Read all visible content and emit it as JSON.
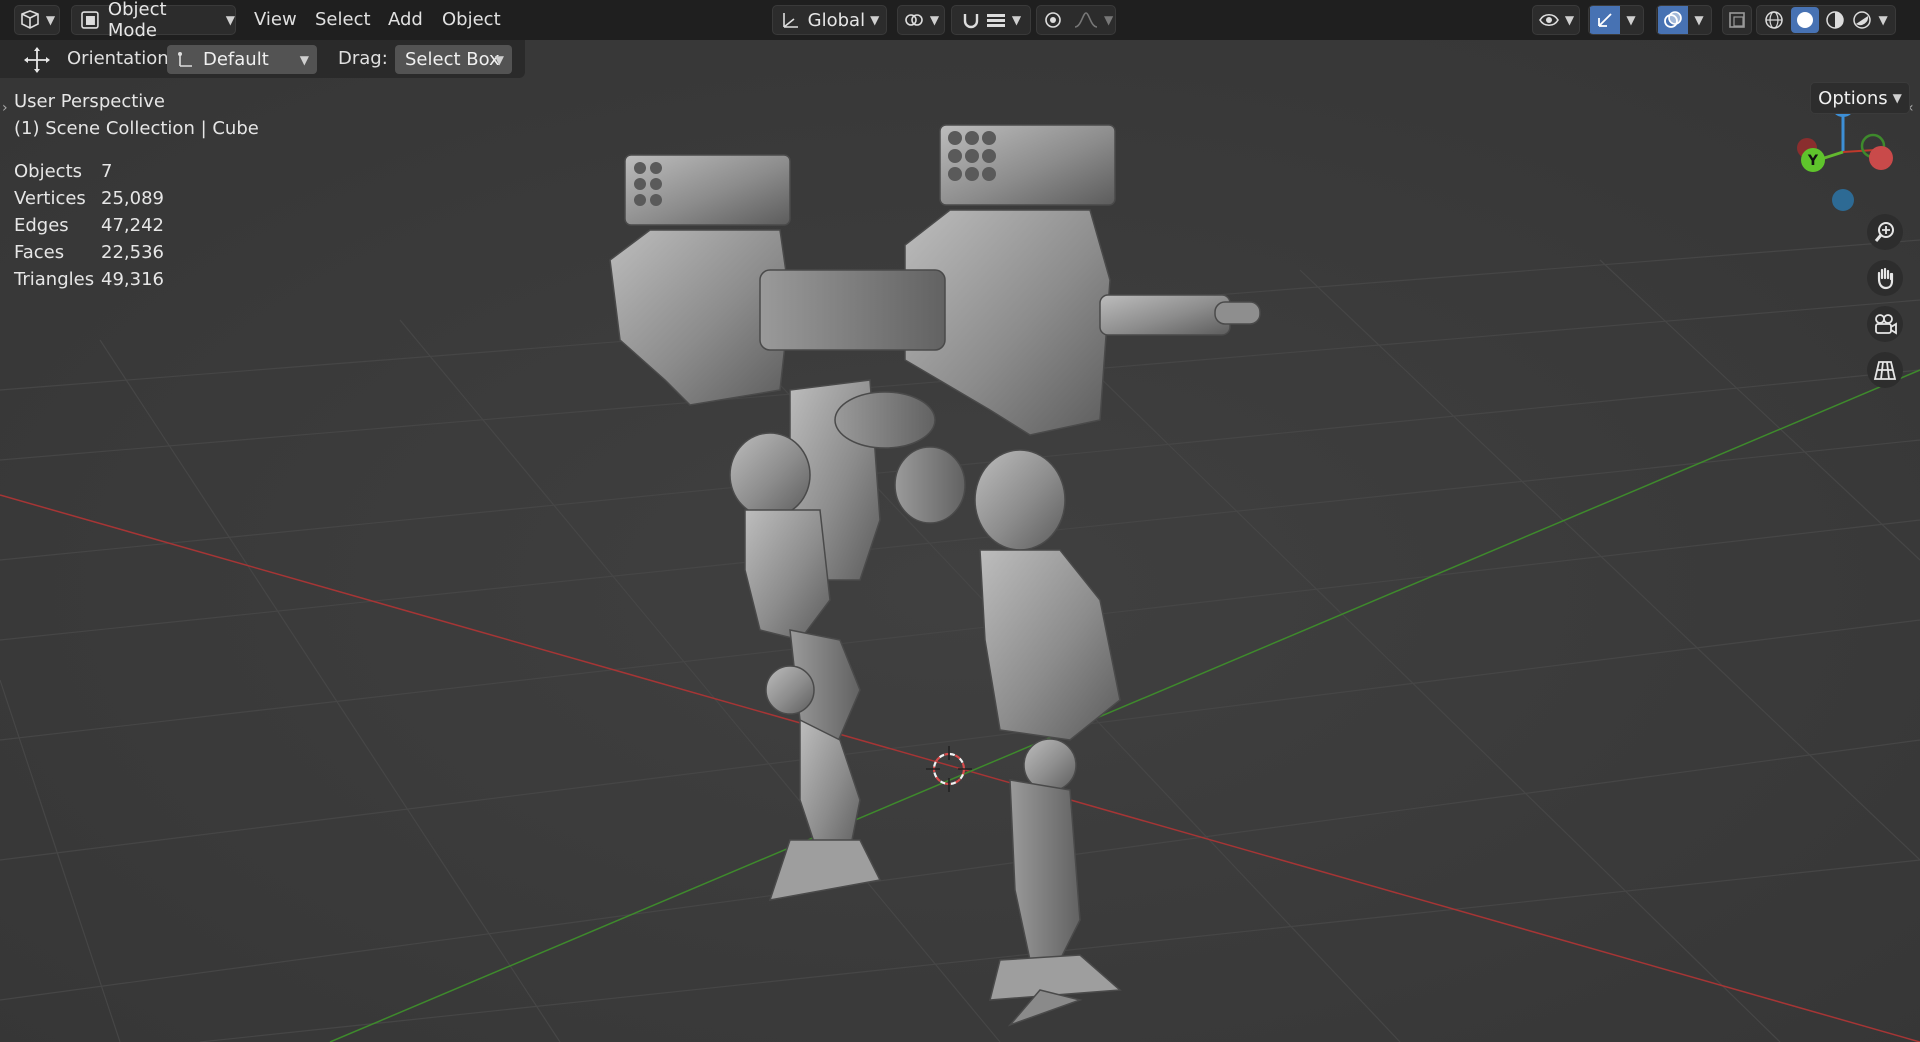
{
  "header": {
    "editor_type_icon": "viewport-editor-icon",
    "mode_label": "Object Mode",
    "menus": [
      "View",
      "Select",
      "Add",
      "Object"
    ],
    "transform_orientation": "Global"
  },
  "tool_settings": {
    "orientation_label": "Orientation:",
    "orientation_value": "Default",
    "drag_label": "Drag:",
    "drag_value": "Select Box"
  },
  "viewport": {
    "perspective_label": "User Perspective",
    "collection_label": "(1) Scene Collection | Cube",
    "options_label": "Options",
    "stats": [
      {
        "name": "Objects",
        "value": "7"
      },
      {
        "name": "Vertices",
        "value": "25,089"
      },
      {
        "name": "Edges",
        "value": "47,242"
      },
      {
        "name": "Faces",
        "value": "22,536"
      },
      {
        "name": "Triangles",
        "value": "49,316"
      }
    ],
    "gizmo": {
      "z": "Z",
      "y": "Y",
      "x": "X"
    }
  },
  "colors": {
    "header_bg": "#1f1f1f",
    "viewport_bg": "#3b3b3b",
    "x_axis": "#b33a3a",
    "y_axis": "#3f8f2e",
    "accent_blue": "#4772b3"
  }
}
